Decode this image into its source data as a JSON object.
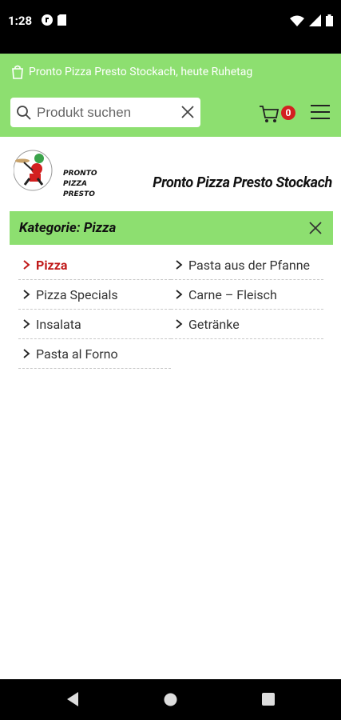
{
  "status_bar": {
    "time": "1:28",
    "icons": [
      "notification-app-icon",
      "sim-card-icon",
      "wifi-icon",
      "signal-icon",
      "battery-icon"
    ]
  },
  "header": {
    "notice": "Pronto Pizza Presto Stockach, heute Ruhetag",
    "search_placeholder": "Produkt suchen",
    "cart_count": "0",
    "accent_color": "#8ddf70"
  },
  "brand": {
    "logo_text_1": "PRONTO",
    "logo_text_2": "PIZZA",
    "logo_text_3": "PRESTO",
    "title": "Pronto Pizza Presto Stockach"
  },
  "category": {
    "title": "Kategorie: Pizza",
    "items": [
      {
        "label": "Pizza",
        "active": true
      },
      {
        "label": "Pasta aus der Pfanne",
        "active": false
      },
      {
        "label": "Pizza Specials",
        "active": false
      },
      {
        "label": "Carne – Fleisch",
        "active": false
      },
      {
        "label": "Insalata",
        "active": false
      },
      {
        "label": "Getränke",
        "active": false
      },
      {
        "label": "Pasta al Forno",
        "active": false
      }
    ],
    "active_color": "#c01818"
  }
}
